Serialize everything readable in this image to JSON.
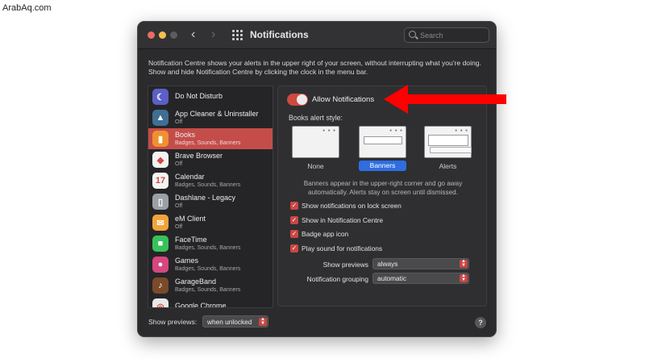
{
  "watermark": "ArabAq.com",
  "window": {
    "title": "Notifications",
    "search_placeholder": "Search",
    "nav_back": "‹",
    "nav_forward": "›"
  },
  "description": "Notification Centre shows your alerts in the upper right of your screen, without interrupting what you're doing. Show and hide Notification Centre by clicking the clock in the menu bar.",
  "apps": [
    {
      "name": "Do Not Disturb",
      "sub": "",
      "icon": "moon-icon",
      "glyph": "☾",
      "color": "#5b5fc7"
    },
    {
      "name": "App Cleaner & Uninstaller",
      "sub": "Off",
      "icon": "app-cleaner-icon",
      "glyph": "▲",
      "color": "#3e6f95"
    },
    {
      "name": "Books",
      "sub": "Badges, Sounds, Banners",
      "icon": "books-icon",
      "glyph": "▮",
      "color": "#f0912f"
    },
    {
      "name": "Brave Browser",
      "sub": "Off",
      "icon": "brave-icon",
      "glyph": "◆",
      "color": "#f2f2f2"
    },
    {
      "name": "Calendar",
      "sub": "Badges, Sounds, Banners",
      "icon": "calendar-icon",
      "glyph": "17",
      "color": "#f4f4f4"
    },
    {
      "name": "Dashlane - Legacy",
      "sub": "Off",
      "icon": "dashlane-icon",
      "glyph": "▯",
      "color": "#9aa0a6"
    },
    {
      "name": "eM Client",
      "sub": "Off",
      "icon": "em-client-icon",
      "glyph": "✉",
      "color": "#f2a33a"
    },
    {
      "name": "FaceTime",
      "sub": "Badges, Sounds, Banners",
      "icon": "facetime-icon",
      "glyph": "■",
      "color": "#38c25a"
    },
    {
      "name": "Games",
      "sub": "Badges, Sounds, Banners",
      "icon": "games-icon",
      "glyph": "●",
      "color": "#d6477f"
    },
    {
      "name": "GarageBand",
      "sub": "Badges, Sounds, Banners",
      "icon": "garageband-icon",
      "glyph": "♪",
      "color": "#7a4a2a"
    },
    {
      "name": "Google Chrome",
      "sub": "",
      "icon": "chrome-icon",
      "glyph": "◎",
      "color": "#e8e8e8"
    }
  ],
  "selected_app_index": 2,
  "detail": {
    "allow_label": "Allow Notifications",
    "alert_style_label": "Books alert style:",
    "styles": [
      "None",
      "Banners",
      "Alerts"
    ],
    "selected_style": "Banners",
    "style_hint": "Banners appear in the upper-right corner and go away automatically. Alerts stay on screen until dismissed.",
    "checks": [
      {
        "label": "Show notifications on lock screen",
        "checked": true
      },
      {
        "label": "Show in Notification Centre",
        "checked": true
      },
      {
        "label": "Badge app icon",
        "checked": true
      },
      {
        "label": "Play sound for notifications",
        "checked": true
      }
    ],
    "show_previews_label": "Show previews",
    "show_previews_value": "always",
    "grouping_label": "Notification grouping",
    "grouping_value": "automatic"
  },
  "bottom": {
    "label": "Show previews:",
    "value": "when unlocked",
    "help": "?"
  },
  "colors": {
    "accent": "#c94744",
    "selection_blue": "#2f6de1",
    "annotation_arrow": "#ff0000"
  }
}
